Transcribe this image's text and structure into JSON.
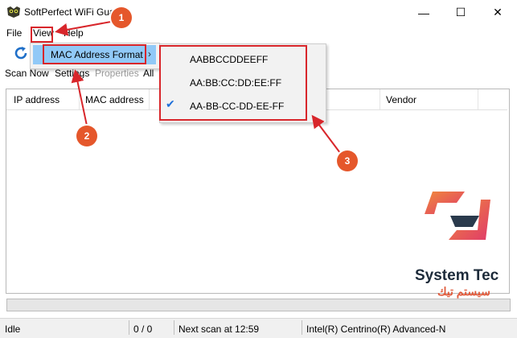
{
  "window": {
    "title": "SoftPerfect WiFi Gua",
    "controls": {
      "minimize": "—",
      "maximize": "☐",
      "close": "✕"
    }
  },
  "menubar": {
    "file": "File",
    "view": "View",
    "help": "Help"
  },
  "toolbar": {
    "scan_now": "Scan Now",
    "settings": "Settings",
    "properties": "Properties",
    "all": "All"
  },
  "view_menu": {
    "mac_format": "MAC Address Format"
  },
  "mac_submenu": {
    "options": [
      "AABBCCDDEEFF",
      "AA:BB:CC:DD:EE:FF",
      "AA-BB-CC-DD-EE-FF"
    ],
    "selected_index": 2
  },
  "columns": [
    "IP address",
    "MAC address",
    "Vendor"
  ],
  "status": {
    "state": "Idle",
    "count": "0 / 0",
    "next_scan": "Next scan at 12:59",
    "adapter": "Intel(R) Centrino(R) Advanced-N"
  },
  "annotations": {
    "step1": "1",
    "step2": "2",
    "step3": "3",
    "color": "#d8262b",
    "badge_color": "#e5572b"
  },
  "watermark": {
    "brand": "System Tec",
    "brand_ar": "سيستم تيك"
  }
}
